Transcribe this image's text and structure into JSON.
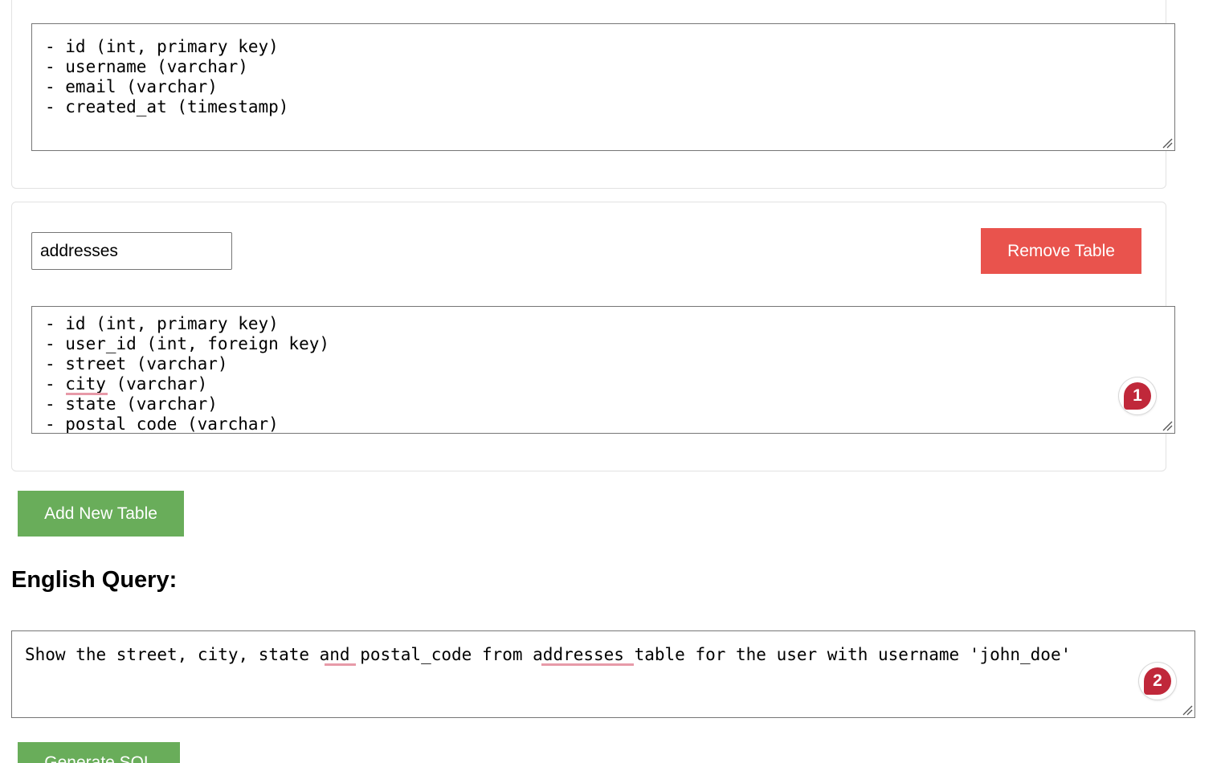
{
  "tables": [
    {
      "columns_text": [
        "- id (int, primary key)",
        "- username (varchar)",
        "- email (varchar)",
        "- created_at (timestamp)"
      ]
    },
    {
      "name": "addresses",
      "remove_label": "Remove Table",
      "columns_text": [
        "- id (int, primary key)",
        "- user_id (int, foreign key)",
        "- street (varchar)",
        "- city (varchar)",
        "- state (varchar)",
        "- postal_code (varchar)"
      ]
    }
  ],
  "add_table_label": "Add New Table",
  "query": {
    "heading": "English Query:",
    "text": "Show the street, city, state and postal_code from addresses table for the user with username 'john_doe'"
  },
  "generate_label": "Generate SQL",
  "badges": {
    "first": "1",
    "second": "2"
  },
  "colors": {
    "remove_button": "#e9534d",
    "green_button": "#69ad5a",
    "badge": "#c0283a",
    "spellcheck_underline": "#e79aa8"
  }
}
